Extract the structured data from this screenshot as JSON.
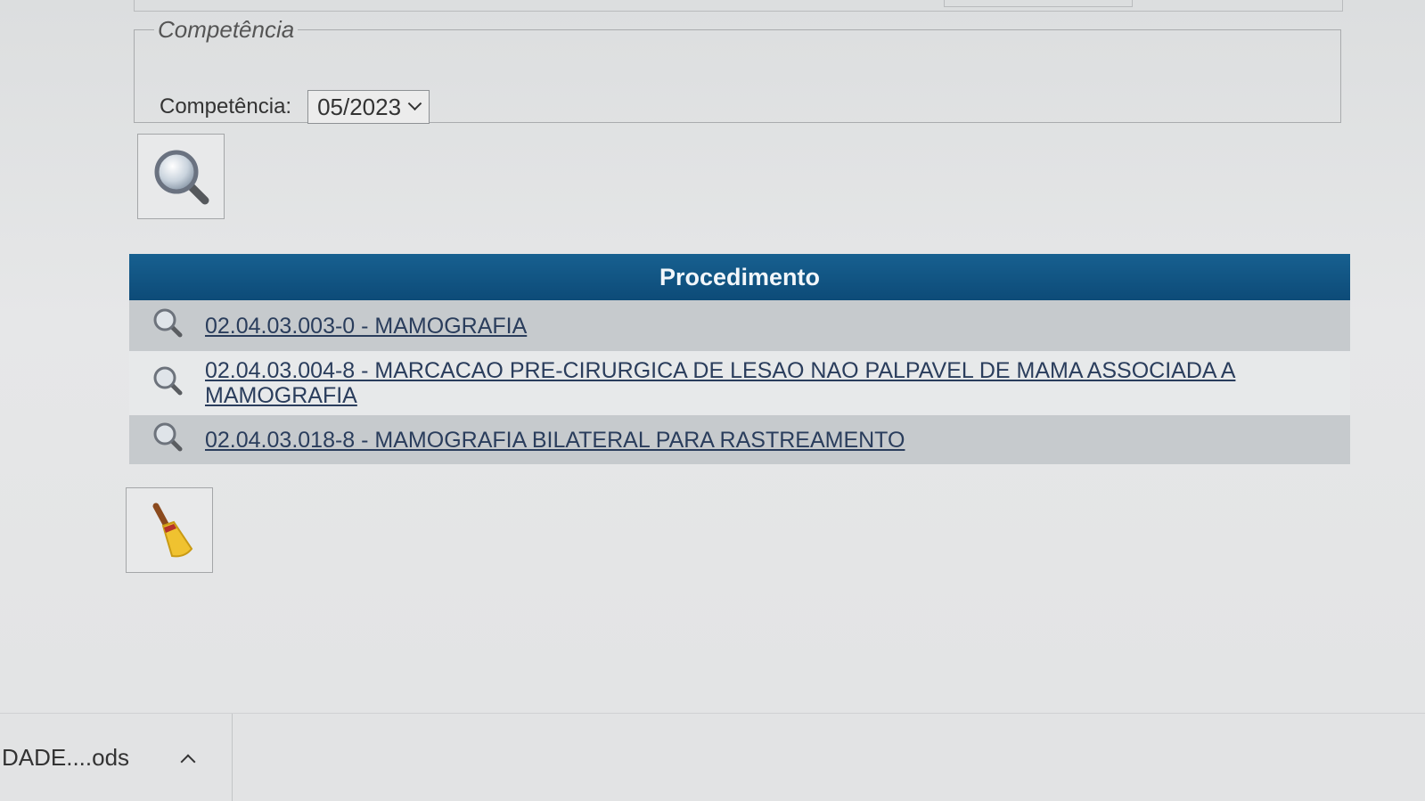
{
  "competencia": {
    "legend": "Competência",
    "label": "Competência:",
    "selected": "05/2023"
  },
  "search_button": {
    "icon": "magnifier-icon"
  },
  "table": {
    "header": "Procedimento",
    "rows": [
      {
        "icon": "magnifier-icon",
        "text": "02.04.03.003-0 - MAMOGRAFIA"
      },
      {
        "icon": "magnifier-icon",
        "text": "02.04.03.004-8 - MARCACAO PRE-CIRURGICA DE LESAO NAO PALPAVEL DE MAMA ASSOCIADA A MAMOGRAFIA"
      },
      {
        "icon": "magnifier-icon",
        "text": "02.04.03.018-8 - MAMOGRAFIA BILATERAL PARA RASTREAMENTO"
      }
    ]
  },
  "clear_button": {
    "icon": "broom-icon"
  },
  "download_bar": {
    "file_name": "DADE....ods",
    "caret_icon": "chevron-up-icon"
  },
  "colors": {
    "table_header": "#0d4b78",
    "link": "#2a3d5c"
  }
}
